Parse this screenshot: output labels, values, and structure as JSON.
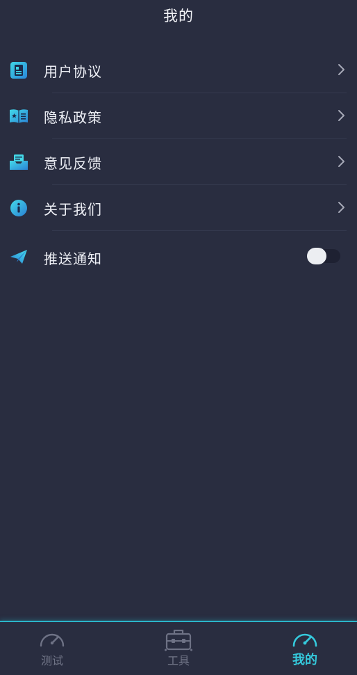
{
  "header": {
    "title": "我的"
  },
  "menu": {
    "items": [
      {
        "label": "用户协议",
        "icon": "document-icon"
      },
      {
        "label": "隐私政策",
        "icon": "open-book-icon"
      },
      {
        "label": "意见反馈",
        "icon": "inbox-icon"
      },
      {
        "label": "关于我们",
        "icon": "info-icon"
      }
    ],
    "push": {
      "label": "推送通知",
      "icon": "paper-plane-icon",
      "enabled": false
    }
  },
  "tabbar": {
    "tabs": [
      {
        "label": "测试",
        "icon": "speedometer-icon",
        "active": false
      },
      {
        "label": "工具",
        "icon": "toolbox-icon",
        "active": false
      },
      {
        "label": "我的",
        "icon": "speedometer-active-icon",
        "active": true
      }
    ]
  },
  "colors": {
    "background": "#292d40",
    "accent": "#35c9dc",
    "text": "#eef0f6",
    "inactive": "#727688"
  }
}
